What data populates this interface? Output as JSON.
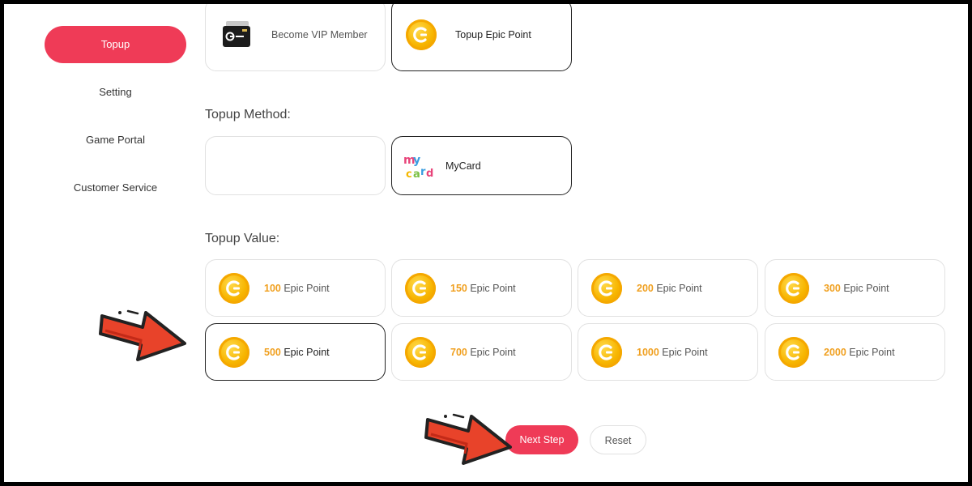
{
  "sidebar": {
    "items": [
      {
        "label": "Topup"
      },
      {
        "label": "Setting"
      },
      {
        "label": "Game Portal"
      },
      {
        "label": "Customer Service"
      }
    ]
  },
  "topup_type": {
    "options": [
      {
        "label": "Become VIP Member"
      },
      {
        "label": "Topup Epic Point"
      }
    ],
    "selected": "Topup Epic Point"
  },
  "topup_method": {
    "title": "Topup Method:",
    "options": [
      {
        "label": ""
      },
      {
        "label": "MyCard",
        "logo_text": "my card"
      }
    ],
    "selected": "MyCard"
  },
  "topup_value": {
    "title": "Topup Value:",
    "unit": "Epic Point",
    "options": [
      {
        "amount": "100"
      },
      {
        "amount": "150"
      },
      {
        "amount": "200"
      },
      {
        "amount": "300"
      },
      {
        "amount": "500"
      },
      {
        "amount": "700"
      },
      {
        "amount": "1000"
      },
      {
        "amount": "2000"
      }
    ],
    "selected": "500"
  },
  "buttons": {
    "next": "Next Step",
    "reset": "Reset"
  },
  "colors": {
    "accent": "#ef3b57",
    "coin": "#f7b500",
    "amount": "#f0a020",
    "arrow": "#e8432a"
  }
}
